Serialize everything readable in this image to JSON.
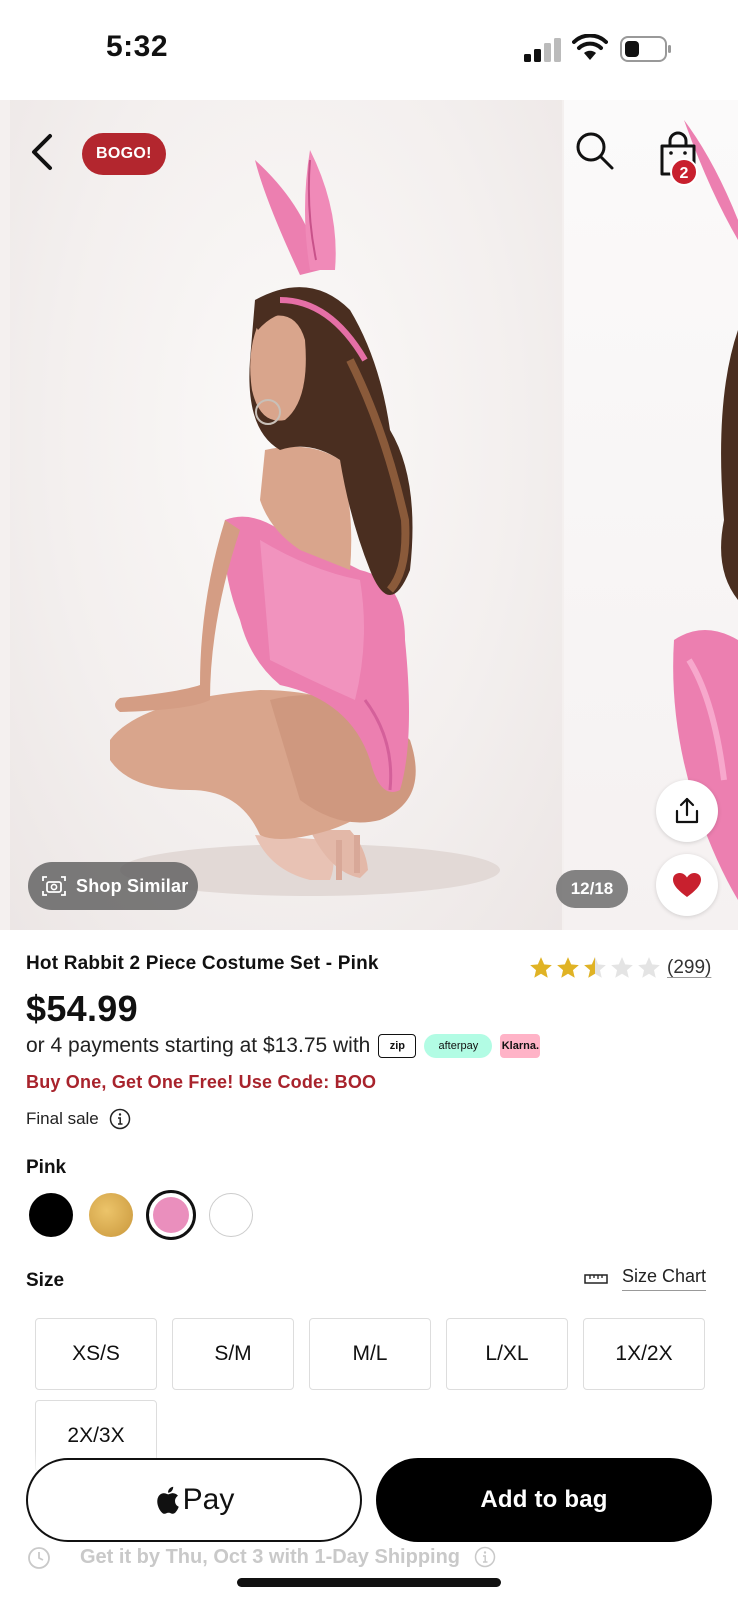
{
  "status_bar": {
    "time": "5:32"
  },
  "header": {
    "badge": "BOGO!",
    "cart_count": "2"
  },
  "gallery": {
    "shop_similar": "Shop Similar",
    "counter": "12/18"
  },
  "product": {
    "title": "Hot Rabbit 2 Piece Costume Set - Pink",
    "rating": 2.5,
    "review_count": "(299)",
    "price": "$54.99",
    "installments": "or 4 payments starting at $13.75 with",
    "pay_logos": [
      "zip",
      "afterpay",
      "Klarna."
    ],
    "promo": "Buy One, Get One Free! Use Code: BOO",
    "final_sale": "Final sale",
    "selected_color": "Pink",
    "colors": [
      {
        "name": "black",
        "hex": "#000000"
      },
      {
        "name": "gold",
        "hex": "#d9ad4e"
      },
      {
        "name": "pink",
        "hex": "#ea8fbd",
        "selected": true
      },
      {
        "name": "white",
        "hex": "#ffffff"
      }
    ],
    "size_label": "Size",
    "size_chart": "Size Chart",
    "sizes": [
      "XS/S",
      "S/M",
      "M/L",
      "L/XL",
      "1X/2X",
      "2X/3X"
    ]
  },
  "actions": {
    "apple_pay": "Pay",
    "add_to_bag": "Add to bag",
    "shipping": "Get it by Thu, Oct 3 with 1-Day Shipping"
  },
  "colors": {
    "brand_red": "#b3262e",
    "star": "#e0b325",
    "promo": "#a8232c"
  }
}
